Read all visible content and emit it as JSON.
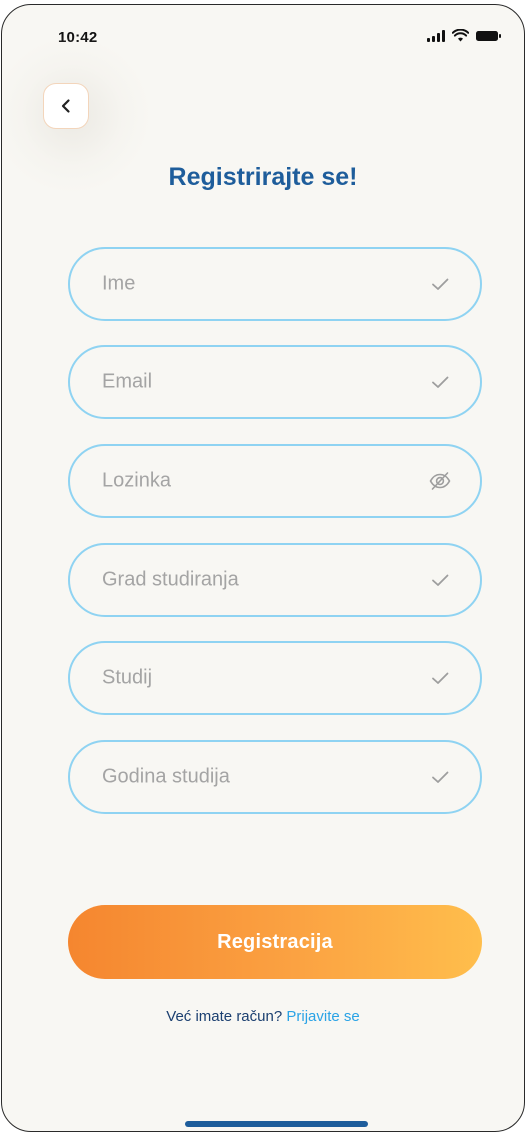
{
  "status_bar": {
    "time": "10:42"
  },
  "header": {
    "title": "Registrirajte se!"
  },
  "form": {
    "fields": [
      {
        "label": "Ime",
        "icon": "check-icon"
      },
      {
        "label": "Email",
        "icon": "check-icon"
      },
      {
        "label": "Lozinka",
        "icon": "eye-off-icon"
      },
      {
        "label": "Grad studiranja",
        "icon": "check-icon"
      },
      {
        "label": "Studij",
        "icon": "check-icon"
      },
      {
        "label": "Godina studija",
        "icon": "check-icon"
      }
    ],
    "submit_label": "Registracija"
  },
  "footer": {
    "prompt_text": "Već imate račun?",
    "login_link": "Prijavite se"
  },
  "colors": {
    "title": "#1e5d9b",
    "field_border": "#8fd3f2",
    "button_gradient_start": "#f5862f",
    "button_gradient_end": "#ffbe4c",
    "link": "#2aa3e6"
  }
}
